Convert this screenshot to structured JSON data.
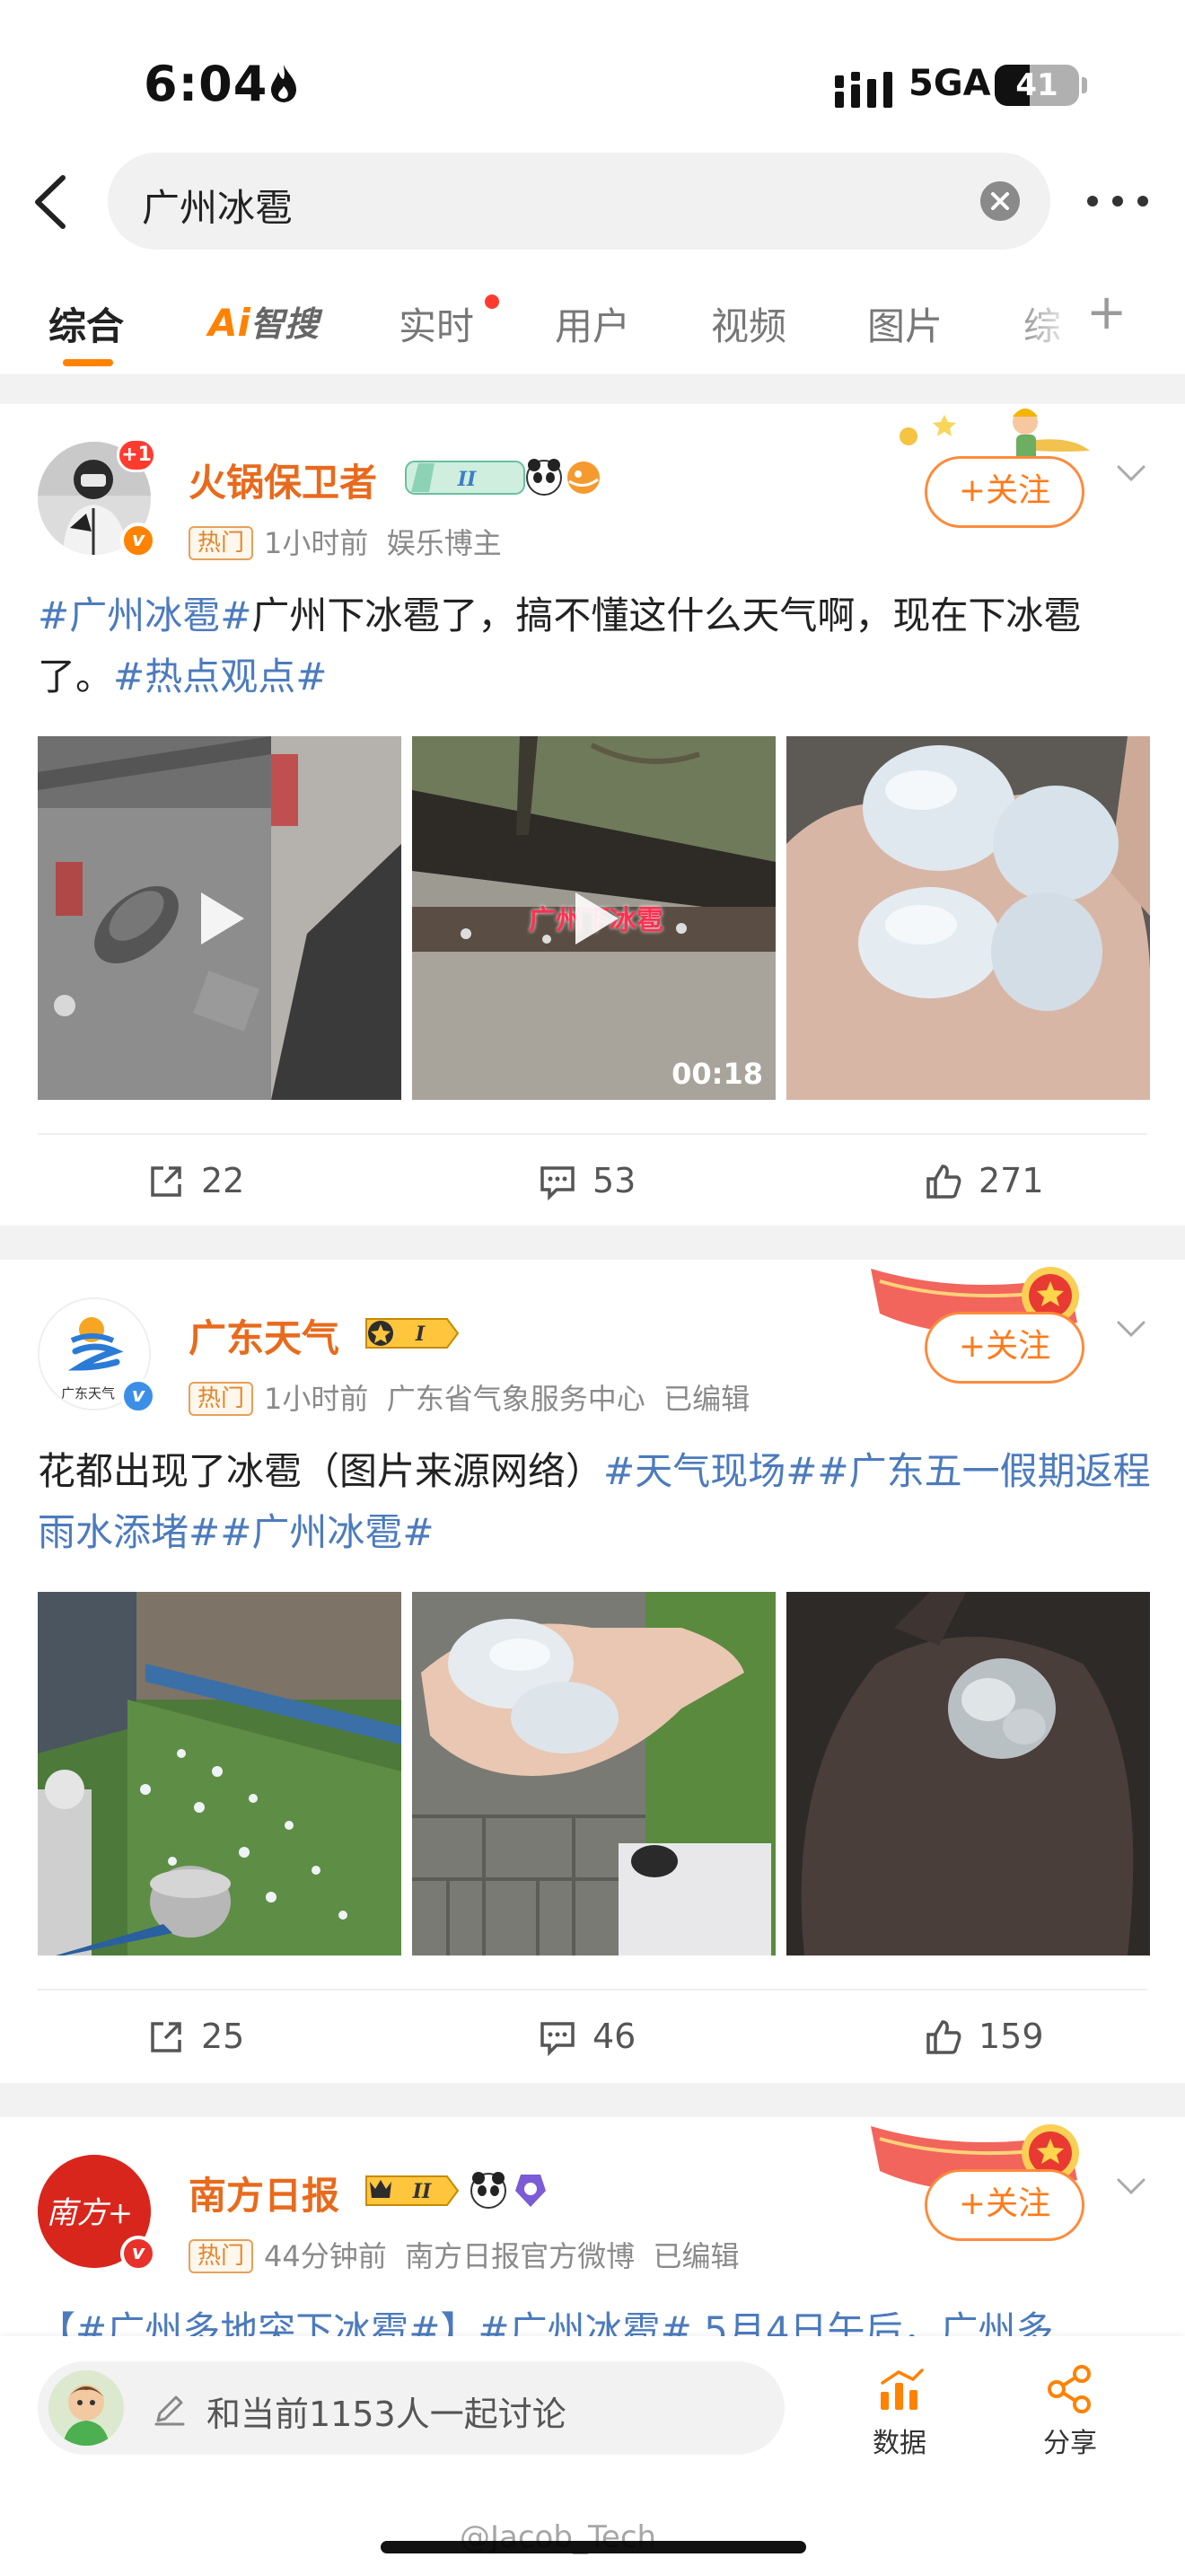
{
  "status_bar": {
    "time": "6:04",
    "network": "5GA",
    "battery": "41",
    "battery_level": 0.41
  },
  "search": {
    "query": "广州冰雹"
  },
  "tabs": [
    {
      "label": "综合"
    },
    {
      "label_ai": "Ai",
      "label_rest": "智搜"
    },
    {
      "label": "实时"
    },
    {
      "label": "用户"
    },
    {
      "label": "视频"
    },
    {
      "label": "图片"
    },
    {
      "label": "综"
    }
  ],
  "posts": [
    {
      "username": "火锅保卫者",
      "badge_level": "II",
      "hot_label": "热门",
      "time": "1小时前",
      "source": "娱乐博主",
      "avatar_badge": "+1",
      "text": [
        {
          "t": "#广州冰雹#",
          "tag": true
        },
        {
          "t": "广州下冰雹了，搞不懂这什么天气啊，现在下冰雹了。",
          "tag": false
        },
        {
          "t": "#热点观点#",
          "tag": true
        }
      ],
      "video_overlay": "广州下冰雹",
      "duration": "00:18",
      "reposts": "22",
      "comments": "53",
      "likes": "271",
      "follow_label": "+关注"
    },
    {
      "username": "广东天气",
      "badge_level": "I",
      "avatar_text": "广东天气",
      "hot_label": "热门",
      "time": "1小时前",
      "source": "广东省气象服务中心",
      "edited": "已编辑",
      "text": [
        {
          "t": "花都出现了冰雹（图片来源网络）",
          "tag": false
        },
        {
          "t": "#天气现场##广东五一假期返程雨水添堵##广州冰雹#",
          "tag": true
        }
      ],
      "reposts": "25",
      "comments": "46",
      "likes": "159",
      "follow_label": "+关注"
    },
    {
      "username": "南方日报",
      "badge_level": "II",
      "avatar_text": "南方+",
      "hot_label": "热门",
      "time": "44分钟前",
      "source": "南方日报官方微博",
      "edited": "已编辑",
      "text_preview": "【#广州多地突下冰雹#】#广州冰雹# 5月4日午后，广州多",
      "follow_label": "+关注"
    }
  ],
  "bottom_bar": {
    "discuss_placeholder": "和当前1153人一起讨论",
    "data_label": "数据",
    "share_label": "分享"
  },
  "watermark": "@Jacob_Tech",
  "colors": {
    "accent": "#ff8200",
    "tag": "#4c7bbd",
    "username": "#e86a1c"
  }
}
